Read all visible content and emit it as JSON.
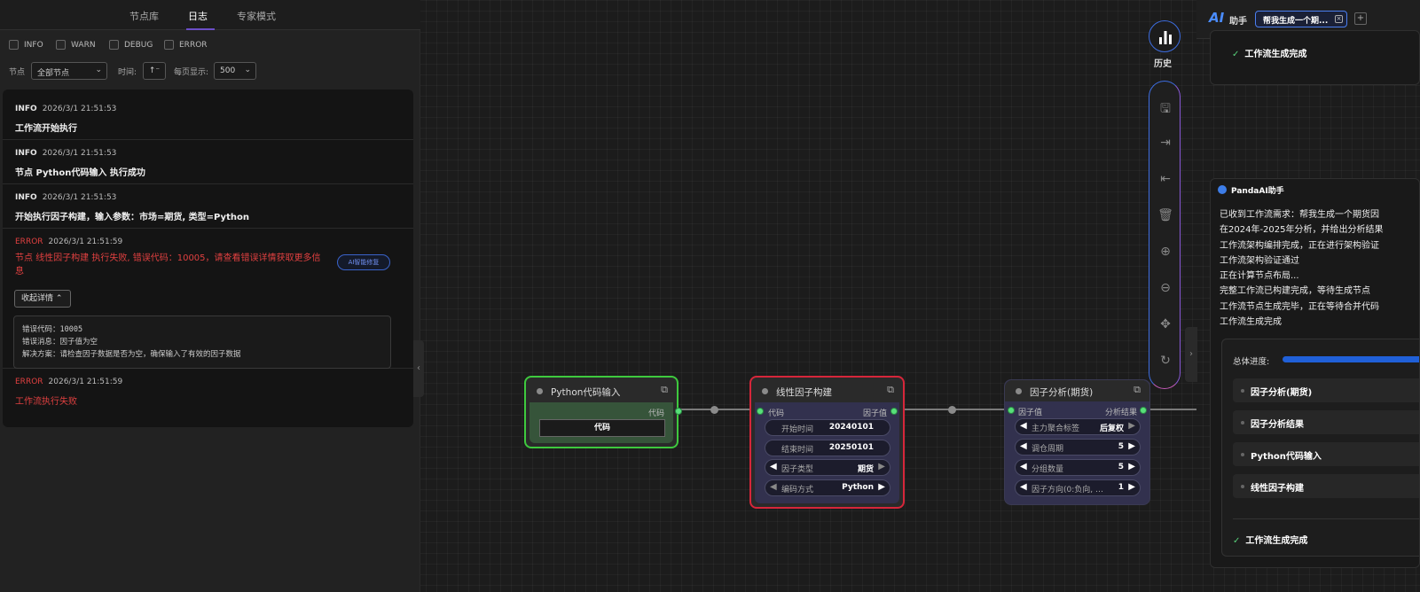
{
  "left_panel": {
    "tabs": [
      "节点库",
      "日志",
      "专家模式"
    ],
    "active_tab": "日志",
    "level_filters": [
      "INFO",
      "WARN",
      "DEBUG",
      "ERROR"
    ],
    "node_label": "节点",
    "node_select": "全部节点",
    "time_label": "时间:",
    "sort_icon": "sort-ascending-icon",
    "per_page_label": "每页显示:",
    "per_page_select": "500",
    "logs": [
      {
        "level": "INFO",
        "time": "2026/3/1 21:51:53",
        "message": "工作流开始执行"
      },
      {
        "level": "INFO",
        "time": "2026/3/1 21:51:53",
        "message": "节点 Python代码输入 执行成功"
      },
      {
        "level": "INFO",
        "time": "2026/3/1 21:51:53",
        "message": "开始执行因子构建，输入参数：市场=期货, 类型=Python"
      },
      {
        "level": "ERROR",
        "time": "2026/3/1 21:51:59",
        "message": "节点 线性因子构建 执行失败, 错误代码：10005，请查看错误详情获取更多信息",
        "action": "AI智能修复",
        "toggle": "收起详情",
        "details": [
          "错误代码：10005",
          "错误消息：因子值为空",
          "解决方案：请检查因子数据是否为空，确保输入了有效的因子数据"
        ]
      },
      {
        "level": "ERROR",
        "time": "2026/3/1 21:51:59",
        "message": "工作流执行失败"
      }
    ]
  },
  "nodes": {
    "python_input": {
      "title": "Python代码输入",
      "out_port": "代码",
      "button": "代码"
    },
    "linear_factor": {
      "title": "线性因子构建",
      "in_port": "代码",
      "out_port": "因子值",
      "fields": [
        {
          "label": "开始时间",
          "value": "20240101"
        },
        {
          "label": "结束时间",
          "value": "20250101"
        },
        {
          "label": "因子类型",
          "value": "期货"
        },
        {
          "label": "编码方式",
          "value": "Python"
        }
      ]
    },
    "factor_analysis": {
      "title": "因子分析(期货)",
      "in_port": "因子值",
      "out_port": "分析结果",
      "fields": [
        {
          "label": "主力聚合标签",
          "value": "后复权"
        },
        {
          "label": "调仓周期",
          "value": "5"
        },
        {
          "label": "分组数量",
          "value": "5"
        },
        {
          "label": "因子方向(0:负向, …",
          "value": "1"
        }
      ]
    }
  },
  "toolbar": {
    "history_label": "历史",
    "icons": [
      "save-icon",
      "export-icon",
      "import-icon",
      "delete-icon",
      "zoom-in-icon",
      "zoom-out-icon",
      "fit-view-icon",
      "reset-icon"
    ]
  },
  "ai_panel": {
    "logo": "AI",
    "title": "助手",
    "tab_label": "帮我生成一个期...",
    "top_done": "工作流生成完成",
    "card_title": "PandaAI助手",
    "messages": [
      "已收到工作流需求：帮我生成一个期货因",
      "在2024年-2025年分析，并给出分析结果",
      "工作流架构编排完成，正在进行架构验证",
      "工作流架构验证通过",
      "正在计算节点布局...",
      "完整工作流已构建完成，等待生成节点",
      "工作流节点生成完毕，正在等待合并代码",
      "工作流生成完成"
    ],
    "progress_label": "总体进度:",
    "progress": 1.0,
    "steps": [
      "因子分析(期货)",
      "因子分析结果",
      "Python代码输入",
      "线性因子构建"
    ],
    "final_done": "工作流生成完成"
  },
  "colors": {
    "accent": "#6b4ec8",
    "error": "#e04040",
    "success": "#58d07a",
    "python_node_border": "#3ec93e",
    "linear_node_border": "#d6263a",
    "link_blue": "#3d6de0"
  }
}
